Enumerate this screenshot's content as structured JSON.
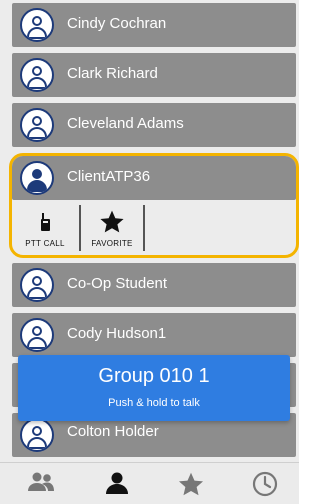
{
  "contacts": [
    {
      "name": "Cindy Cochran"
    },
    {
      "name": "Clark Richard"
    },
    {
      "name": "Cleveland Adams"
    },
    {
      "name": "ClientATP36"
    },
    {
      "name": "Co-Op Student"
    },
    {
      "name": "Cody Hudson1"
    },
    {
      "name": "Colton Holder"
    }
  ],
  "selected_actions": {
    "ptt_call_label": "PTT CALL",
    "favorite_label": "FAVORITE"
  },
  "toast": {
    "title": "Group 010 1",
    "subtitle": "Push & hold to talk"
  },
  "tabbar": {
    "tabs": [
      {
        "icon": "groups-icon",
        "active": false
      },
      {
        "icon": "contact-icon",
        "active": true
      },
      {
        "icon": "star-icon",
        "active": false
      },
      {
        "icon": "clock-icon",
        "active": false
      }
    ]
  },
  "colors": {
    "row_bg": "#8d8d8d",
    "selected_border": "#f4b400",
    "toast_bg": "#2f7de1",
    "avatar_outline": "#1d3a7a"
  }
}
